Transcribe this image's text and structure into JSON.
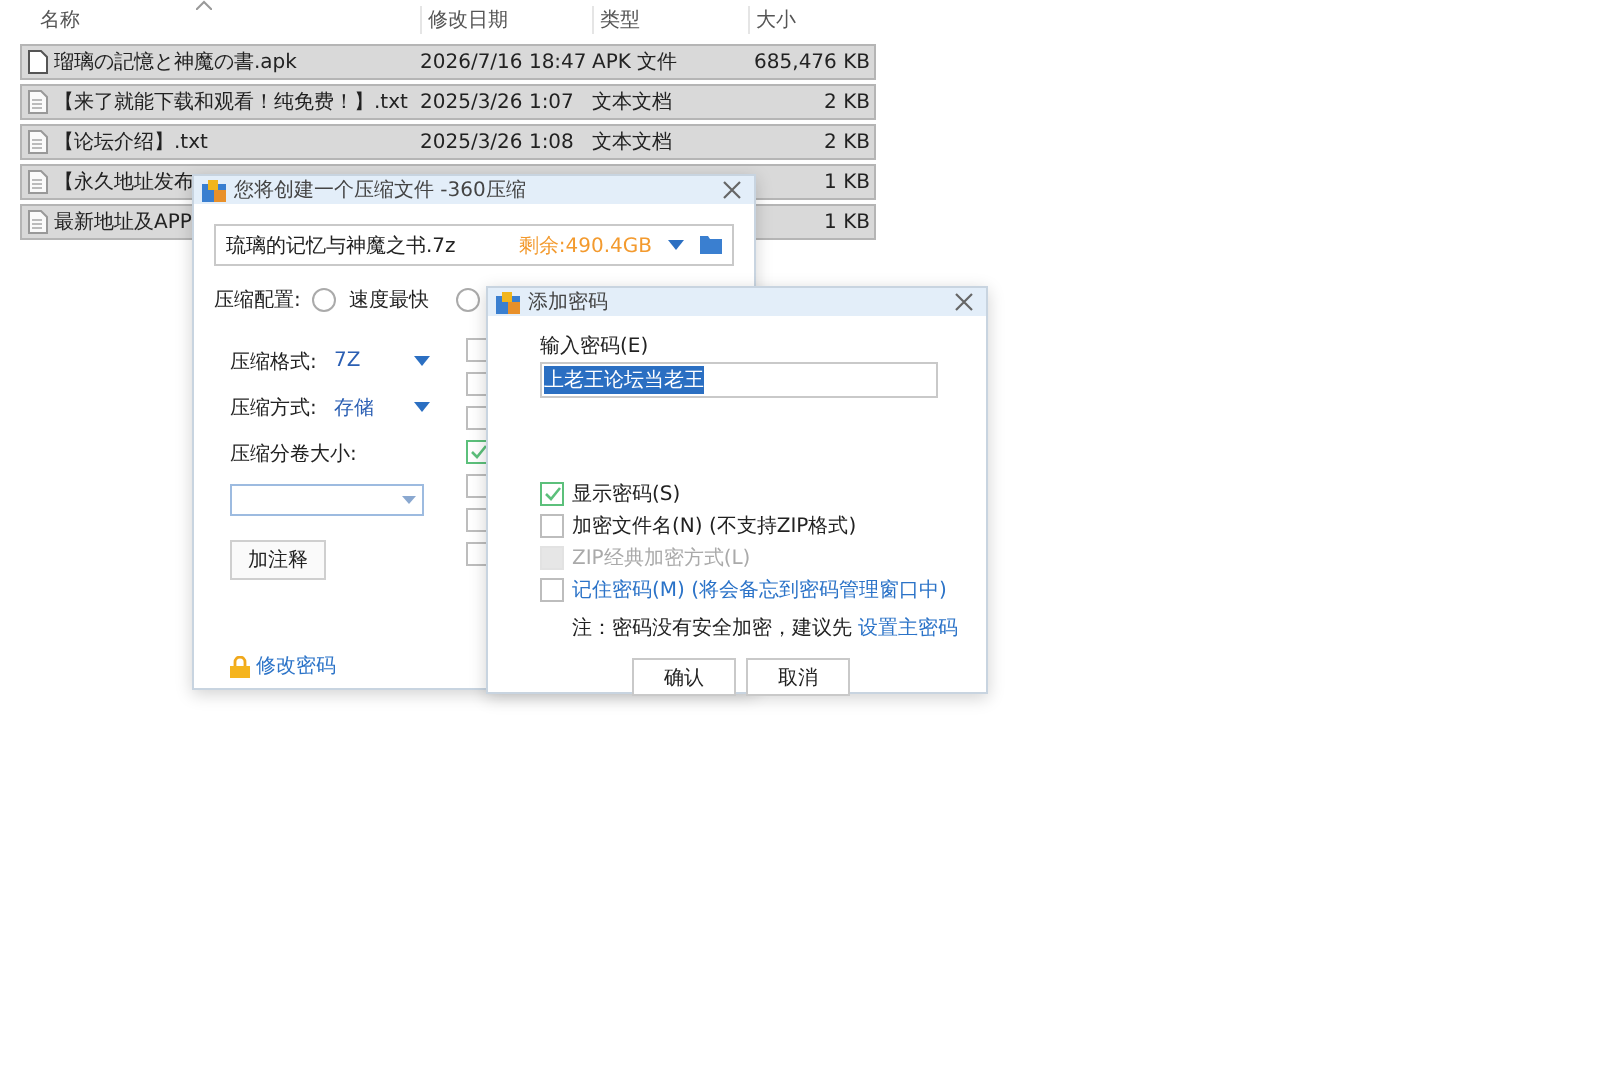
{
  "file_list": {
    "columns": [
      "名称",
      "修改日期",
      "类型",
      "大小"
    ],
    "rows": [
      {
        "kind": "apk",
        "name": "瑠璃の記憶と神魔の書.apk",
        "date": "2026/7/16 18:47",
        "type": "APK 文件",
        "size": "685,476 KB",
        "selected": true
      },
      {
        "kind": "txt",
        "name": "【来了就能下载和观看！纯免费！】.txt",
        "date": "2025/3/26 1:07",
        "type": "文本文档",
        "size": "2 KB",
        "selected": true
      },
      {
        "kind": "txt",
        "name": "【论坛介绍】.txt",
        "date": "2025/3/26 1:08",
        "type": "文本文档",
        "size": "2 KB",
        "selected": true
      },
      {
        "kind": "txt",
        "name": "【永久地址发布",
        "size": "1 KB",
        "selected": true
      },
      {
        "kind": "txt",
        "name": "最新地址及APP",
        "size": "1 KB",
        "selected": true
      }
    ]
  },
  "compress_dialog": {
    "title": "您将创建一个压缩文件 -360压缩",
    "file_name": "琉璃的记忆与神魔之书.7z",
    "free_space": "剩余:490.4GB",
    "config_label": "压缩配置:",
    "presets": [
      {
        "label": "速度最快",
        "selected": false
      },
      {
        "selected": false
      }
    ],
    "format_label": "压缩格式:",
    "format_value": "7Z",
    "method_label": "压缩方式:",
    "method_value": "存储",
    "volume_label": "压缩分卷大小:",
    "comment_button": "加注释",
    "option_checkboxes": [
      {
        "checked": false
      },
      {
        "checked": false
      },
      {
        "checked": false
      },
      {
        "checked": true
      },
      {
        "checked": false
      },
      {
        "checked": false
      },
      {
        "checked": false
      }
    ],
    "change_password_link": "修改密码"
  },
  "password_dialog": {
    "title": "添加密码",
    "input_label": "输入密码(E)",
    "password": "上老王论坛当老王",
    "options": [
      {
        "kind": "plain",
        "label": "显示密码(S)",
        "checked": true,
        "disabled": false
      },
      {
        "kind": "plain",
        "label": "加密文件名(N) (不支持ZIP格式)",
        "checked": false,
        "disabled": false
      },
      {
        "kind": "plain",
        "label": "ZIP经典加密方式(L)",
        "checked": false,
        "disabled": true
      },
      {
        "kind": "link",
        "label": "记住密码(M) (将会备忘到密码管理窗口中)",
        "checked": false,
        "disabled": false
      }
    ],
    "note_text": "注：密码没有安全加密，建议先",
    "note_link": "设置主密码",
    "buttons": [
      "确认",
      "取消"
    ]
  }
}
